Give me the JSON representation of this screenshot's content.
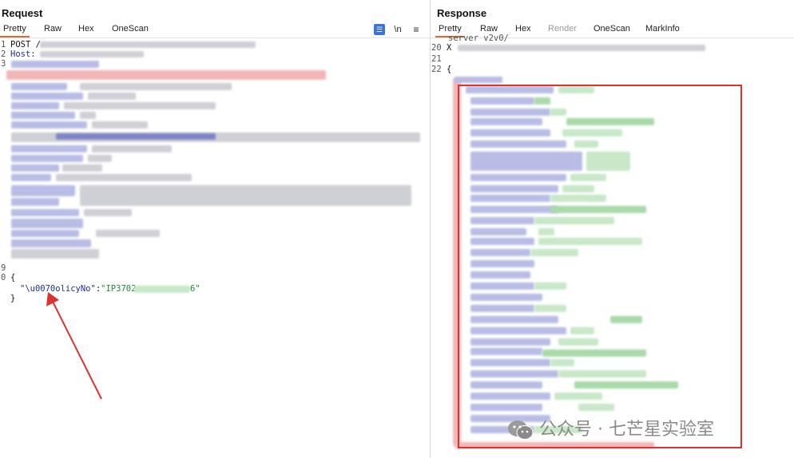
{
  "request": {
    "title": "Request",
    "tabs": [
      "Pretty",
      "Raw",
      "Hex",
      "OneScan"
    ],
    "active_tab": "Pretty",
    "toolbar": {
      "wrap_icon": "wrap-lines-icon",
      "newline_label": "\\n",
      "menu_icon": "menu-icon"
    },
    "lines": {
      "n1": "1",
      "n2": "2",
      "n3": "3",
      "n9": "9",
      "n0": "0",
      "method": "POST /",
      "host_label": "Host:",
      "brace_open": "{",
      "json_key": "\"\\u0070olicyNo\"",
      "json_colon": ":",
      "json_value_visible_start": "\"IP3702",
      "json_value_visible_end": "6\"",
      "brace_close": "}"
    }
  },
  "response": {
    "title": "Response",
    "tabs": [
      "Pretty",
      "Raw",
      "Hex",
      "Render",
      "OneScan",
      "MarkInfo"
    ],
    "active_tab": "Pretty",
    "disabled_tabs": [
      "Render"
    ],
    "lines": {
      "partial_header": "server v2v0/",
      "n20": "20",
      "n21": "21",
      "n22": "22",
      "l20_prefix": "X",
      "brace_open": "{"
    }
  },
  "watermark": {
    "text": "公众号 · 七芒星实验室",
    "icon": "wechat-icon"
  },
  "annotation_colors": {
    "arrow": "#e03131",
    "highlight_box": "#e03131"
  }
}
